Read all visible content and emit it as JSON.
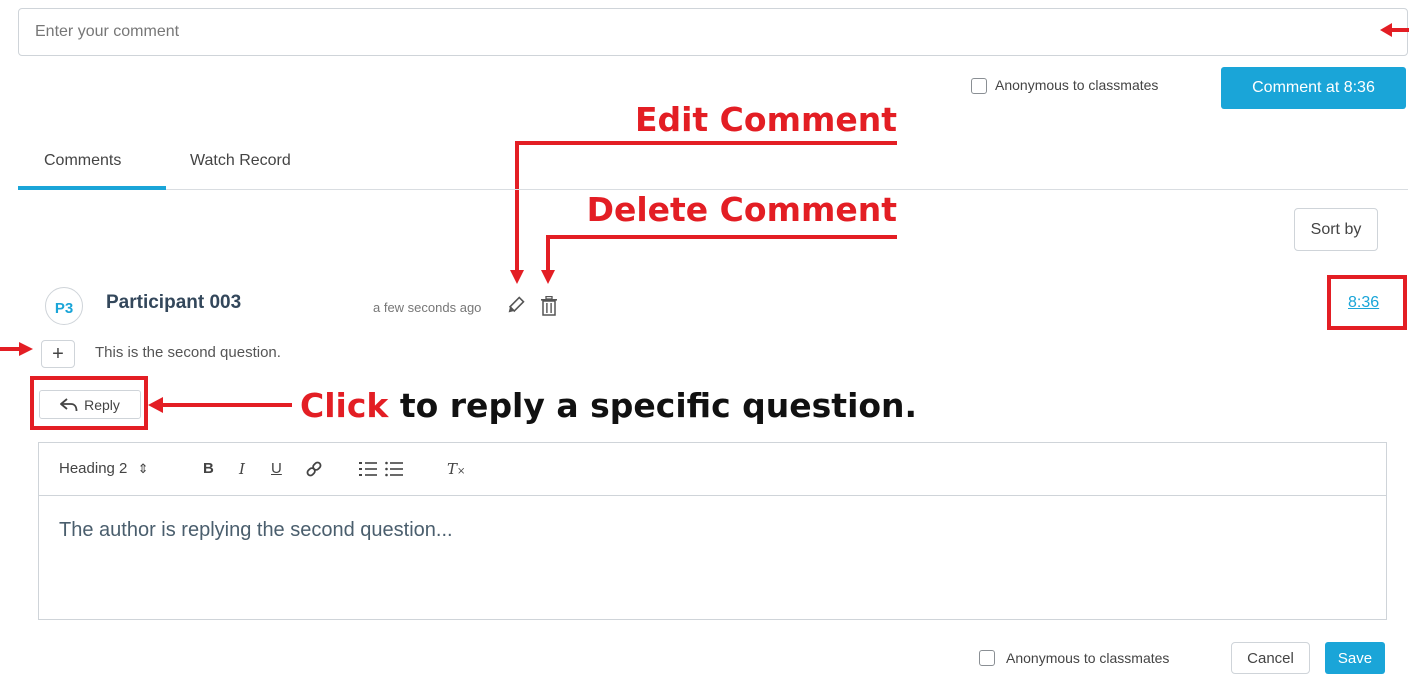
{
  "composer": {
    "placeholder": "Enter your comment",
    "anonymous_label": "Anonymous to classmates",
    "submit_label": "Comment at 8:36"
  },
  "tabs": [
    {
      "label": "Comments",
      "active": true
    },
    {
      "label": "Watch Record",
      "active": false
    }
  ],
  "sort_label": "Sort by",
  "annotations": {
    "edit": "Edit Comment",
    "delete": "Delete Comment",
    "click_word": "Click",
    "reply_hint": " to reply a specific question."
  },
  "comment": {
    "avatar": "P3",
    "author": "Participant 003",
    "time": "a few seconds ago",
    "timestamp": "8:36",
    "expand_symbol": "+",
    "text": "This is the second question.",
    "reply_label": "Reply"
  },
  "editor": {
    "heading_select": "Heading 2",
    "heading_arrows": "⇕",
    "bold": "B",
    "italic": "I",
    "underline": "U",
    "clear_format": "T",
    "content": "The author is replying the second question..."
  },
  "reply_footer": {
    "anonymous_label": "Anonymous to classmates",
    "cancel_label": "Cancel",
    "save_label": "Save"
  },
  "colors": {
    "accent": "#1aa5d8",
    "annotation_red": "#e31e24"
  }
}
